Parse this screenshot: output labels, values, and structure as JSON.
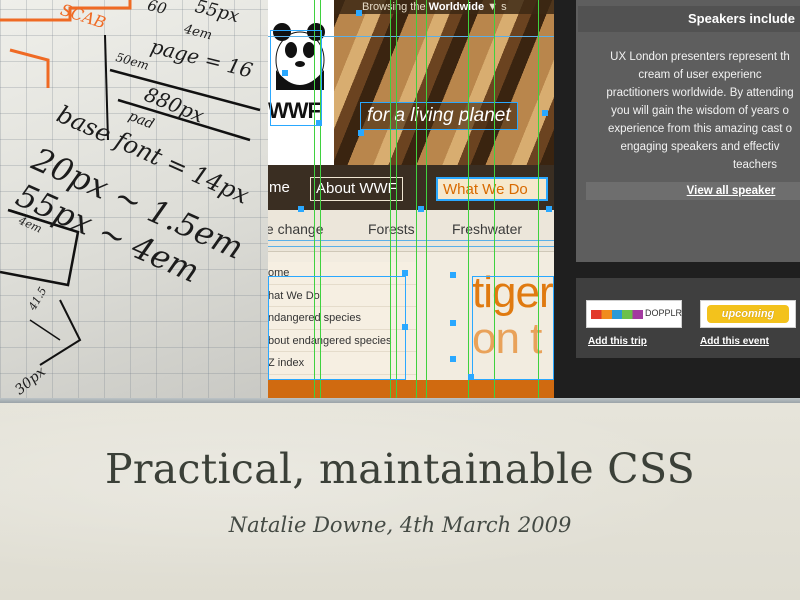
{
  "slide": {
    "title": "Practical, maintainable CSS",
    "subtitle": "Natalie Downe, 4th March 2009"
  },
  "sketch": {
    "annotations": [
      "SCAB",
      "60",
      "55px",
      "4em",
      "page = 16",
      "50em",
      "880px",
      "pad",
      "base font = 14px",
      "20px ~ 1.5em",
      "55px ~ 4em",
      "4em",
      "41.5",
      "30px"
    ]
  },
  "wwf": {
    "browse_prefix": "Browsing the",
    "browse_region": "Worldwide",
    "browse_arrow": "▼",
    "browse_suffix": "s",
    "logo_text": "WWF",
    "tagline": "for a living planet",
    "nav": [
      "me",
      "About WWF",
      "What We Do"
    ],
    "subnav": [
      "te change",
      "Forests",
      "Freshwater"
    ],
    "side_links": [
      "ome",
      "hat We Do",
      "ndangered species",
      "bout endangered species",
      "Z index"
    ],
    "feature_words": [
      "tiger",
      "on t"
    ]
  },
  "uxlondon": {
    "heading": "Speakers include",
    "body_lines": [
      "UX London presenters represent th",
      "cream of user experienc",
      "practitioners worldwide. By attending",
      "you will gain the wisdom of years o",
      "experience from this amazing cast o",
      "engaging speakers and effectiv",
      "teachers"
    ],
    "view_all": "View all speaker",
    "dopplr_label": "DOPPLR",
    "upcoming_label": "upcoming",
    "add_trip": "Add this trip",
    "add_event": "Add this event"
  },
  "colors": {
    "background": "#e4e2d8",
    "title_text": "#3b4038",
    "grid_guide": "#3fd13f",
    "select_handle": "#2aa8ff",
    "sketch_highlight": "#ef6a24"
  }
}
